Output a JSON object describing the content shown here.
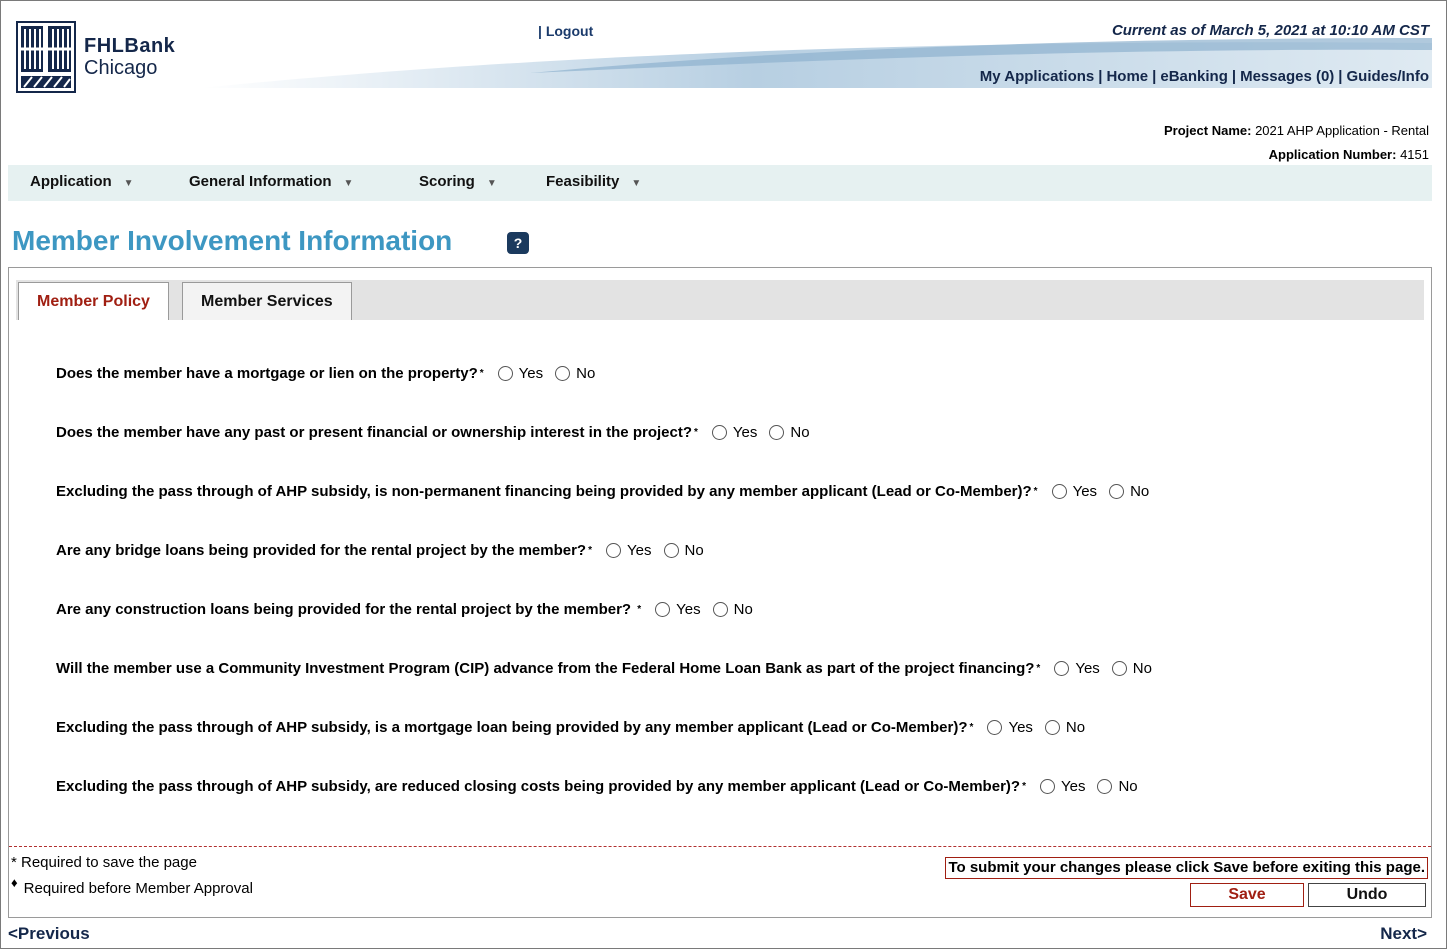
{
  "header": {
    "logo_line1": "FHLBank",
    "logo_line2": "Chicago",
    "logout_prefix": "| ",
    "logout_label": "Logout",
    "as_of": "Current as of March 5, 2021 at 10:10 AM CST",
    "links": [
      "My Applications",
      "Home",
      "eBanking",
      "Messages (0)",
      "Guides/Info"
    ],
    "link_separator": "|"
  },
  "project": {
    "name_label": "Project Name:",
    "name_value": "2021 AHP Application - Rental",
    "number_label": "Application Number:",
    "number_value": "4151"
  },
  "nav": {
    "items": [
      "Application",
      "General Information",
      "Scoring",
      "Feasibility"
    ],
    "caret": "▼"
  },
  "page": {
    "title": "Member Involvement Information",
    "help_icon": "?"
  },
  "tabs": [
    {
      "label": "Member Policy",
      "active": true
    },
    {
      "label": "Member Services",
      "active": false
    }
  ],
  "questions": [
    {
      "text": "Does the member have a mortgage or lien on the property?",
      "marker": "*",
      "options": [
        "Yes",
        "No"
      ],
      "selected": null
    },
    {
      "text": "Does the member have any past or present financial or ownership interest in the project?",
      "marker": "*",
      "options": [
        "Yes",
        "No"
      ],
      "selected": null
    },
    {
      "text": "Excluding the pass through of AHP subsidy, is non-permanent financing being provided by any member applicant (Lead or Co-Member)?",
      "marker": "*",
      "options": [
        "Yes",
        "No"
      ],
      "selected": null
    },
    {
      "text": "Are any bridge loans being provided for the rental project by the member?",
      "marker": "*",
      "options": [
        "Yes",
        "No"
      ],
      "selected": null
    },
    {
      "text": "Are any construction loans being provided for the rental project by the member? ",
      "marker": "*",
      "options": [
        "Yes",
        "No"
      ],
      "selected": null
    },
    {
      "text": "Will the member use a Community Investment Program (CIP) advance from the Federal Home Loan Bank as part of the project financing?",
      "marker": "*",
      "options": [
        "Yes",
        "No"
      ],
      "selected": null
    },
    {
      "text": "Excluding the pass through of AHP subsidy, is a mortgage loan being provided by any member applicant (Lead or Co-Member)?",
      "marker": "*",
      "options": [
        "Yes",
        "No"
      ],
      "selected": null
    },
    {
      "text": "Excluding the pass through of AHP subsidy, are reduced closing costs being provided by any member applicant (Lead or Co-Member)?",
      "marker": "*",
      "options": [
        "Yes",
        "No"
      ],
      "selected": null
    }
  ],
  "footer": {
    "required_save": "* Required to save the page",
    "required_approval": "Required before Member Approval",
    "diamond": "♦",
    "submit_note": "To submit your changes please click Save before exiting this page.",
    "save_label": "Save",
    "undo_label": "Undo"
  },
  "pager": {
    "previous": "<Previous",
    "next": "Next>"
  },
  "colors": {
    "accent_title": "#3d97c2",
    "active_tab": "#a01f12",
    "nav_bg": "#e6f1f1",
    "brand_navy": "#14274a"
  }
}
